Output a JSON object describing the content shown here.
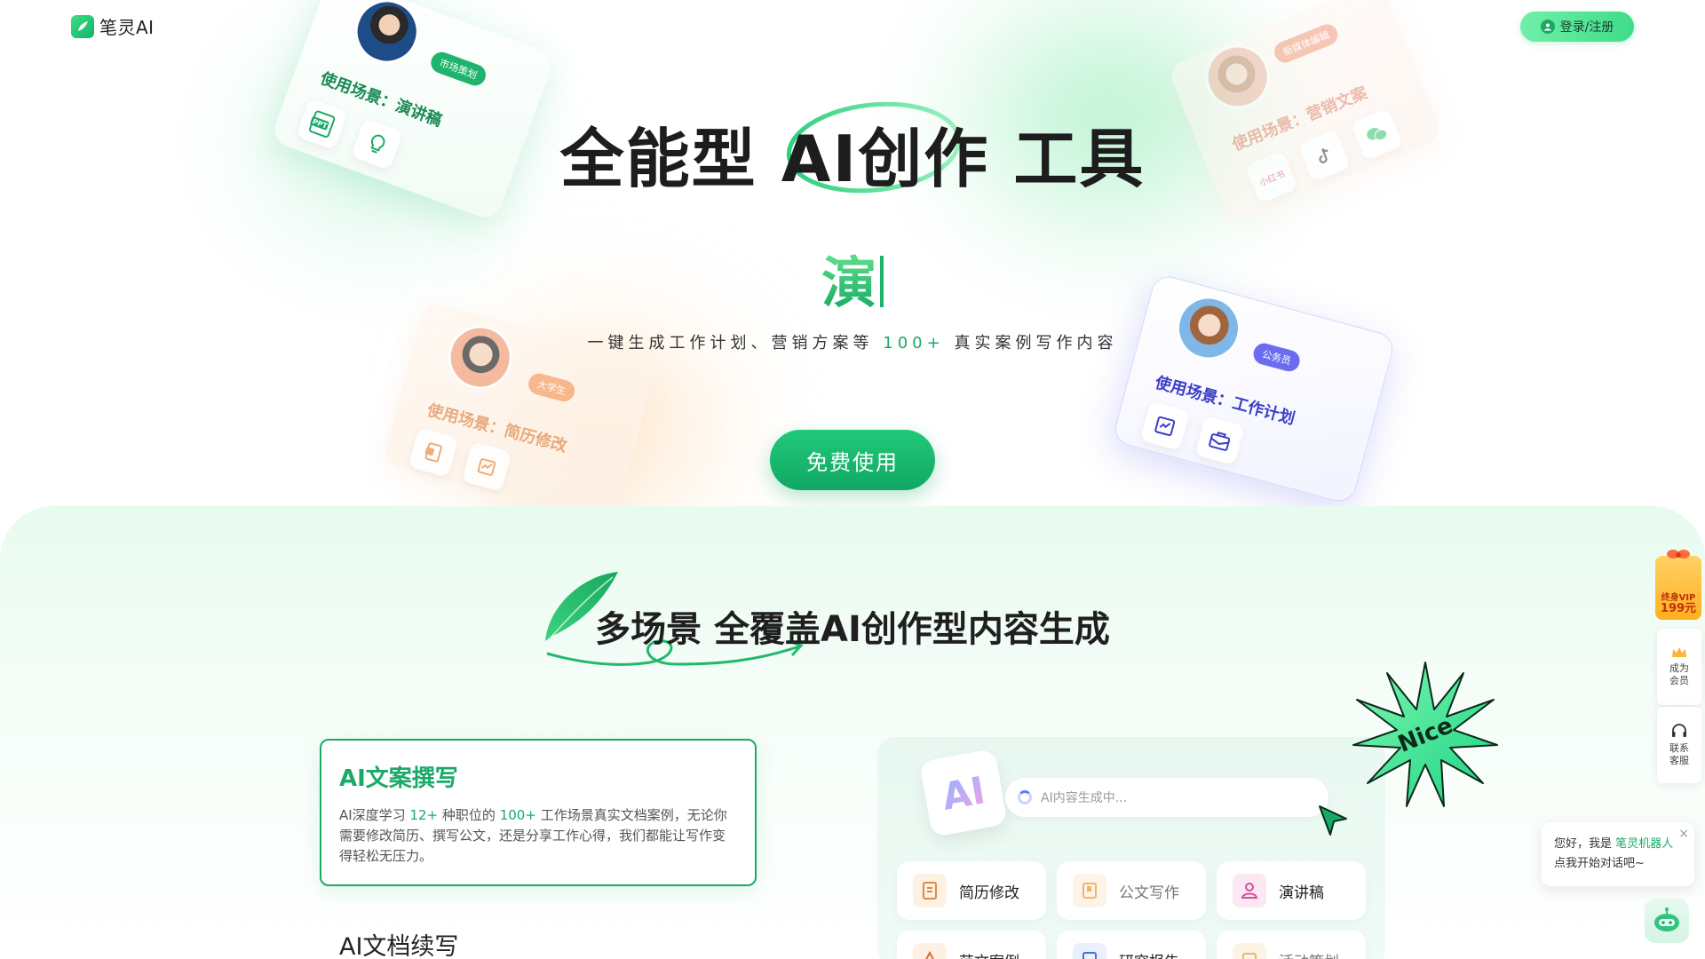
{
  "header": {
    "logo_text": "笔灵AI",
    "login_label": "登录/注册"
  },
  "hero": {
    "title": "全能型 AI创作 工具",
    "typing_text": "演",
    "subtitle_before": "一键生成工作计划、营销方案等",
    "subtitle_accent": "100+",
    "subtitle_after": "真实案例写作内容",
    "cta_label": "免费使用"
  },
  "persona_cards": [
    {
      "role": "市场策划",
      "scene": "使用场景：演讲稿",
      "tools": [
        "PPT",
        "lightbulb-icon"
      ]
    },
    {
      "role": "新媒体编辑",
      "scene": "使用场景：营销文案",
      "tools": [
        "小红书",
        "tiktok-icon",
        "wechat-icon"
      ]
    },
    {
      "role": "大学生",
      "scene": "使用场景：简历修改",
      "tools": [
        "document-icon",
        "chart-icon"
      ]
    },
    {
      "role": "公务员",
      "scene": "使用场景：工作计划",
      "tools": [
        "chart-icon",
        "briefcase-icon"
      ]
    }
  ],
  "section": {
    "title": "多场景 全覆盖AI创作型内容生成",
    "feature_title": "AI文案撰写",
    "feature_desc_1": "AI深度学习",
    "feature_hl_1": "12+",
    "feature_desc_2": "种职位的",
    "feature_hl_2": "100+",
    "feature_desc_3": "工作场景真实文档案例，无论你需要修改简历、撰写公文，还是分享工作心得，我们都能让写作变得轻松无压力。",
    "next_feature_title": "AI文档续写"
  },
  "demo": {
    "ai_tile": "AI",
    "generating_text": "AI内容生成中...",
    "chips": [
      "简历修改",
      "公文写作",
      "演讲稿",
      "范文案例",
      "研究报告",
      "活动策划"
    ],
    "nice_label": "Nice"
  },
  "sidebar": {
    "vip_line1": "终身VIP",
    "vip_line2": "199元",
    "member_label": "成为会员",
    "support_label": "联系客服"
  },
  "chat": {
    "greeting": "您好，我是",
    "bot_name": "笔灵机器人",
    "prompt": "点我开始对话吧~",
    "close": "×"
  },
  "colors": {
    "brand": "#1aaa68",
    "cta": "#10a863",
    "section_bg": "#e8fbef",
    "blue_card_accent": "#6b6df0"
  }
}
